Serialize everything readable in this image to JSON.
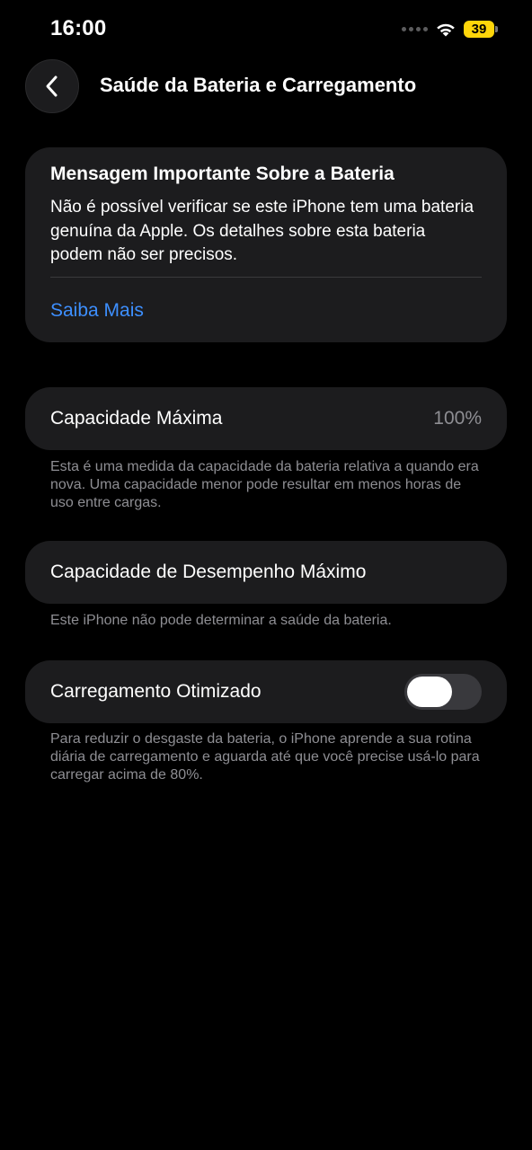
{
  "status_bar": {
    "time": "16:00",
    "battery_level": "39",
    "icons": [
      "cellular-signal-icon",
      "wifi-icon",
      "battery-icon"
    ],
    "battery_color": "#ffd60a"
  },
  "nav": {
    "back_icon": "chevron-left-icon",
    "title": "Saúde da Bateria e Carregamento"
  },
  "battery_message": {
    "title": "Mensagem Importante Sobre a Bateria",
    "body": "Não é possível verificar se este iPhone tem uma bateria genuína da Apple. Os detalhes sobre esta bateria podem não ser precisos.",
    "link_label": "Saiba Mais",
    "link_color": "#3d8fff"
  },
  "max_capacity": {
    "label": "Capacidade Máxima",
    "value": "100%",
    "footnote": "Esta é uma medida da capacidade da bateria relativa a quando era nova. Uma capacidade menor pode resultar em menos horas de uso entre cargas."
  },
  "peak_performance": {
    "label": "Capacidade de Desempenho Máximo",
    "footnote": "Este iPhone não pode determinar a saúde da bateria."
  },
  "optimized_charging": {
    "label": "Carregamento Otimizado",
    "enabled": false,
    "footnote": "Para reduzir o desgaste da bateria, o iPhone aprende a sua rotina diária de carregamento e aguarda até que você precise usá-lo para carregar acima de 80%."
  }
}
